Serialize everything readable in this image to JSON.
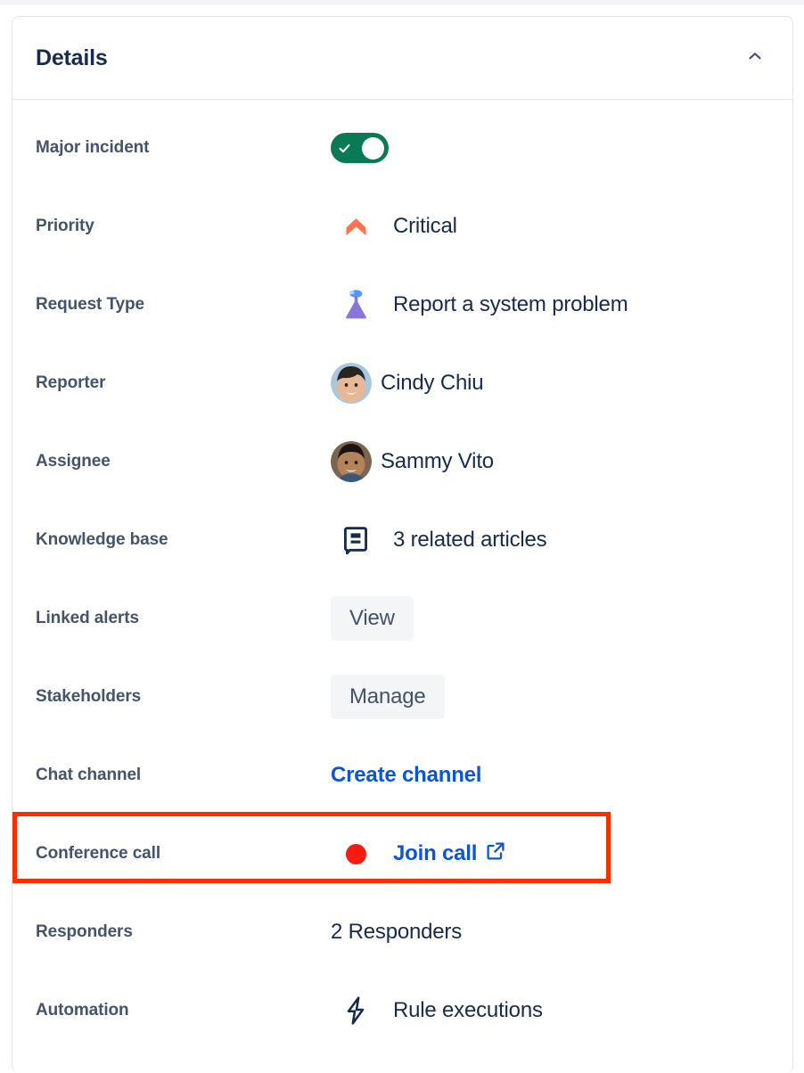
{
  "card": {
    "title": "Details",
    "collapse_icon": "chevron-up-icon"
  },
  "fields": [
    {
      "label": "Major incident",
      "type": "toggle",
      "value": "on",
      "toggle_color": "#0a7a55",
      "icon": "check-icon"
    },
    {
      "label": "Priority",
      "type": "icon-text",
      "value": "Critical",
      "icon": "priority-critical-icon",
      "icon_color": "#ff7452"
    },
    {
      "label": "Request Type",
      "type": "icon-text",
      "value": "Report a system problem",
      "icon": "flask-icon",
      "icon_color": "#8777d9"
    },
    {
      "label": "Reporter",
      "type": "avatar-text",
      "value": "Cindy Chiu",
      "icon": "user-avatar"
    },
    {
      "label": "Assignee",
      "type": "avatar-text",
      "value": "Sammy Vito",
      "icon": "user-avatar"
    },
    {
      "label": "Knowledge base",
      "type": "icon-text",
      "value": "3 related articles",
      "icon": "book-icon",
      "icon_color": "#172b4d"
    },
    {
      "label": "Linked alerts",
      "type": "button",
      "value": "View"
    },
    {
      "label": "Stakeholders",
      "type": "button",
      "value": "Manage"
    },
    {
      "label": "Chat channel",
      "type": "link",
      "value": "Create channel",
      "link_color": "#0e55d4"
    },
    {
      "label": "Conference call",
      "type": "call-link",
      "value": "Join call",
      "dot_color": "#f81b12",
      "icon": "external-link-icon",
      "highlighted": "true"
    },
    {
      "label": "Responders",
      "type": "text",
      "value": "2 Responders"
    },
    {
      "label": "Automation",
      "type": "icon-text",
      "value": "Rule executions",
      "icon": "lightning-bolt-icon",
      "icon_color": "#172b4d"
    }
  ]
}
